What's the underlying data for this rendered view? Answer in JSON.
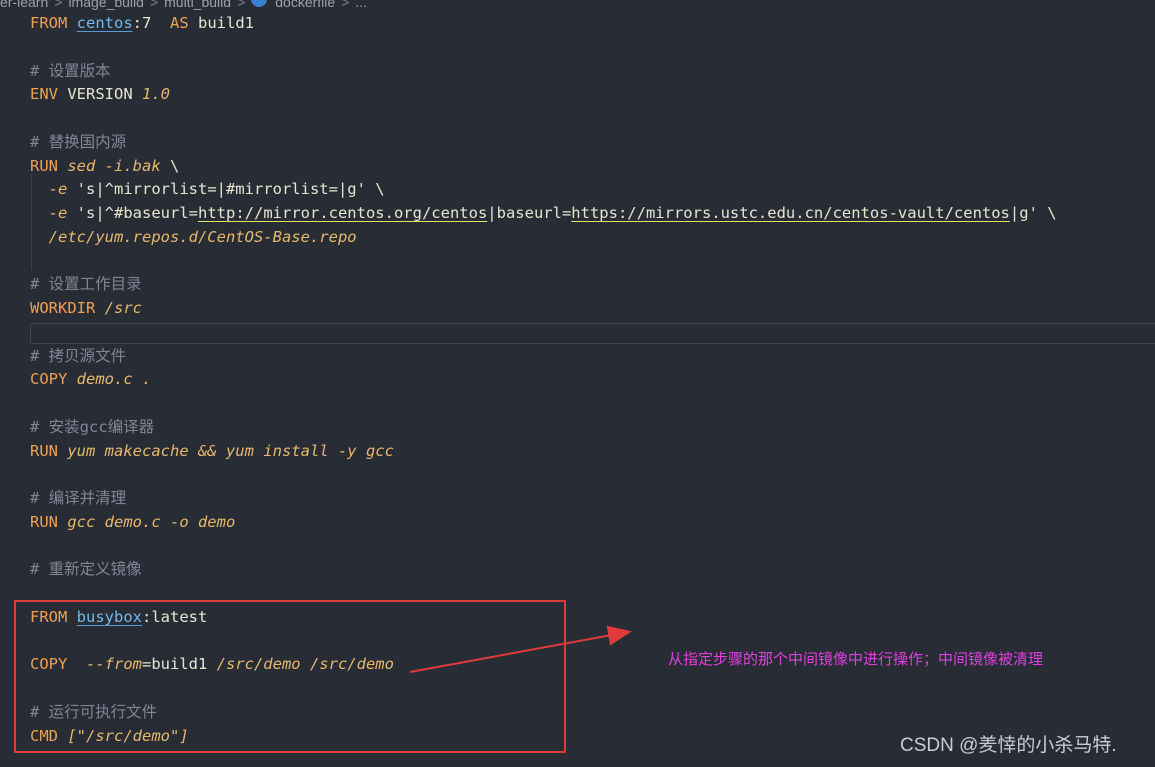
{
  "breadcrumb": {
    "items": [
      "er-learn",
      "image_build",
      "multi_build",
      "dockerfile",
      "..."
    ],
    "separator": ">"
  },
  "code": {
    "lines": {
      "l1": {
        "kw": "FROM",
        "image": "centos",
        "rest": ":7  ",
        "kw2": "AS",
        "name": " build1"
      },
      "l3": "# 设置版本",
      "l4": {
        "kw": "ENV",
        "var": " VERSION ",
        "val": "1.0"
      },
      "l6": "# 替换国内源",
      "l7": {
        "kw": "RUN",
        "cmd": " sed -i.bak ",
        "cont": "\\"
      },
      "l8": {
        "flag": "  -e ",
        "str": "'s|^mirrorlist=|#mirrorlist=|g'",
        "cont": " \\"
      },
      "l9": {
        "flag": "  -e ",
        "s1": "'s|^#baseurl=",
        "u1": "http://mirror.centos.org/centos",
        "s2": "|baseurl=",
        "u2": "https://mirrors.ustc.edu.cn/centos-vault/centos",
        "s3": "|g'",
        "cont": " \\"
      },
      "l10": "  /etc/yum.repos.d/CentOS-Base.repo",
      "l12": "# 设置工作目录",
      "l13": {
        "kw": "WORKDIR",
        "arg": " /src"
      },
      "l15": "# 拷贝源文件",
      "l16": {
        "kw": "COPY",
        "arg": " demo.c ."
      },
      "l18": "# 安装gcc编译器",
      "l19": {
        "kw": "RUN",
        "arg": " yum makecache && yum install -y gcc"
      },
      "l21": "# 编译并清理",
      "l22": {
        "kw": "RUN",
        "arg": " gcc demo.c -o demo"
      },
      "l24": "# 重新定义镜像",
      "l26": {
        "kw": "FROM",
        "image": "busybox",
        "rest": ":latest"
      },
      "l28": {
        "kw": "COPY",
        "flag": "  --from",
        "eq": "=build1",
        "arg": " /src/demo /src/demo"
      },
      "l30": "# 运行可执行文件",
      "l31": {
        "kw": "CMD",
        "arg": " [\"/src/demo\"]"
      }
    }
  },
  "annotation": {
    "text": "从指定步骤的那个中间镜像中进行操作；中间镜像被清理",
    "color": "#e040e0",
    "box_color": "#e03a3a"
  },
  "watermark": "CSDN @羑悻的小杀马特."
}
